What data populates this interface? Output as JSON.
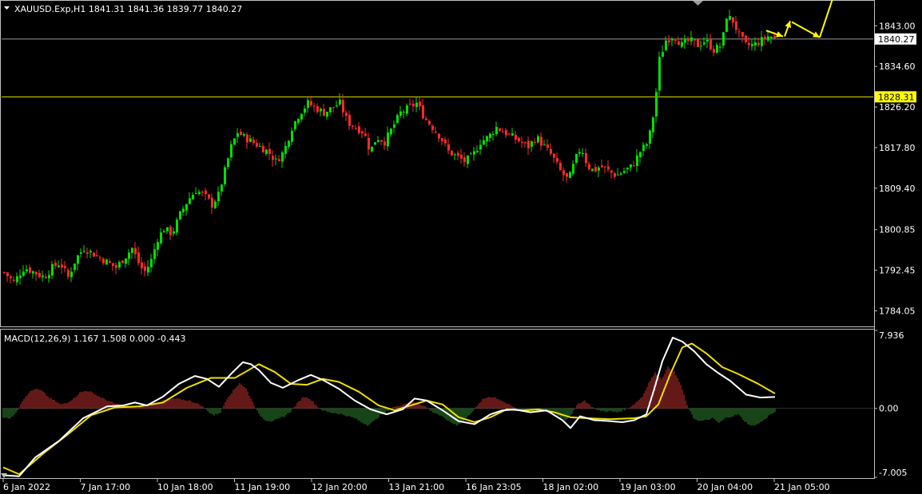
{
  "window": {
    "symbol_header": "XAUUSD.Exp,H1  1841.31 1841.36 1839.77 1840.27",
    "macd_header": "MACD(12,26,9) 1.167 1.508 0.000 -0.443"
  },
  "colors": {
    "background": "#000000",
    "frame": "#c0c0c0",
    "bull_candle": "#00e000",
    "bear_candle": "#ff2a2a",
    "bid_line": "#9a9a9a",
    "level_line": "#e0e000",
    "level_label_bg": "#ffff00",
    "macd_main": "#ffffff",
    "macd_signal": "#f0e000",
    "hist_positive": "#c83232",
    "hist_negative": "#2f8a2f",
    "arrows": "#ffff00"
  },
  "icons": {
    "header_menu": "triangle-down-icon",
    "shift_marker": "triangle-down-icon"
  },
  "chart_data": [
    {
      "type": "candlestick",
      "title": "XAUUSD.Exp,H1",
      "last_ohlc": {
        "open": 1841.31,
        "high": 1841.36,
        "low": 1839.77,
        "close": 1840.27
      },
      "y_ticks": [
        "1843.00",
        "1834.60",
        "1826.20",
        "1817.80",
        "1809.40",
        "1800.85",
        "1792.45",
        "1784.05"
      ],
      "ylim": [
        1781.0,
        1848.0
      ],
      "x_ticks": [
        "6 Jan 2022",
        "7 Jan 17:00",
        "10 Jan 18:00",
        "11 Jan 19:00",
        "12 Jan 20:00",
        "13 Jan 21:00",
        "16 Jan 23:05",
        "18 Jan 02:00",
        "19 Jan 03:00",
        "20 Jan 04:00",
        "21 Jan 05:00"
      ],
      "bid_price": "1840.27",
      "horizontal_level": "1828.31",
      "close_path": [
        [
          0,
          1792
        ],
        [
          12,
          1790
        ],
        [
          25,
          1793
        ],
        [
          38,
          1792
        ],
        [
          50,
          1791
        ],
        [
          60,
          1793
        ],
        [
          70,
          1794
        ],
        [
          80,
          1791
        ],
        [
          90,
          1795
        ],
        [
          100,
          1797
        ],
        [
          110,
          1796
        ],
        [
          120,
          1795
        ],
        [
          130,
          1794
        ],
        [
          140,
          1793
        ],
        [
          150,
          1795
        ],
        [
          160,
          1797
        ],
        [
          168,
          1794
        ],
        [
          175,
          1792
        ],
        [
          183,
          1794
        ],
        [
          192,
          1799
        ],
        [
          200,
          1801
        ],
        [
          210,
          1800
        ],
        [
          220,
          1804
        ],
        [
          230,
          1807
        ],
        [
          240,
          1809
        ],
        [
          250,
          1808
        ],
        [
          260,
          1806
        ],
        [
          268,
          1808
        ],
        [
          276,
          1813
        ],
        [
          284,
          1818
        ],
        [
          292,
          1821
        ],
        [
          300,
          1820
        ],
        [
          310,
          1819
        ],
        [
          320,
          1818
        ],
        [
          330,
          1817
        ],
        [
          340,
          1815
        ],
        [
          350,
          1817
        ],
        [
          360,
          1822
        ],
        [
          370,
          1825
        ],
        [
          380,
          1827
        ],
        [
          390,
          1826
        ],
        [
          400,
          1825
        ],
        [
          410,
          1826
        ],
        [
          420,
          1827
        ],
        [
          430,
          1823
        ],
        [
          440,
          1822
        ],
        [
          450,
          1821
        ],
        [
          458,
          1817
        ],
        [
          466,
          1820
        ],
        [
          476,
          1819
        ],
        [
          486,
          1822
        ],
        [
          496,
          1825
        ],
        [
          506,
          1826
        ],
        [
          516,
          1827
        ],
        [
          526,
          1824
        ],
        [
          536,
          1822
        ],
        [
          546,
          1820
        ],
        [
          556,
          1817
        ],
        [
          566,
          1816
        ],
        [
          576,
          1815
        ],
        [
          586,
          1816
        ],
        [
          596,
          1819
        ],
        [
          606,
          1820
        ],
        [
          616,
          1822
        ],
        [
          626,
          1821
        ],
        [
          636,
          1820
        ],
        [
          646,
          1819
        ],
        [
          656,
          1818
        ],
        [
          666,
          1820
        ],
        [
          676,
          1818
        ],
        [
          686,
          1816
        ],
        [
          696,
          1813
        ],
        [
          706,
          1811
        ],
        [
          714,
          1815
        ],
        [
          722,
          1818
        ],
        [
          730,
          1814
        ],
        [
          738,
          1813
        ],
        [
          746,
          1814
        ],
        [
          756,
          1813
        ],
        [
          766,
          1812
        ],
        [
          776,
          1813
        ],
        [
          786,
          1814
        ],
        [
          796,
          1817
        ],
        [
          806,
          1819
        ],
        [
          814,
          1826
        ],
        [
          820,
          1836
        ],
        [
          828,
          1840
        ],
        [
          838,
          1841
        ],
        [
          848,
          1839
        ],
        [
          858,
          1840
        ],
        [
          868,
          1839
        ],
        [
          878,
          1840
        ],
        [
          888,
          1838
        ],
        [
          898,
          1839
        ],
        [
          904,
          1845
        ],
        [
          912,
          1844
        ],
        [
          920,
          1841
        ],
        [
          928,
          1839
        ],
        [
          938,
          1839
        ],
        [
          948,
          1840
        ],
        [
          958,
          1841
        ],
        [
          966,
          1840
        ]
      ],
      "annotations": [
        {
          "type": "arrow_path",
          "points": [
            [
              955,
              1842.0
            ],
            [
              976,
              1840.8
            ]
          ]
        },
        {
          "type": "arrow_path",
          "points": [
            [
              978,
              1840.8
            ],
            [
              985,
              1844.0
            ]
          ]
        },
        {
          "type": "arrow_path",
          "points": [
            [
              987,
              1843.8
            ],
            [
              1022,
              1840.6
            ]
          ]
        },
        {
          "type": "arrow_path",
          "points": [
            [
              1022,
              1840.6
            ],
            [
              1043,
              1851.0
            ]
          ]
        }
      ]
    },
    {
      "type": "macd",
      "title": "MACD(12,26,9)",
      "values": {
        "main": 1.167,
        "signal": 1.508,
        "v3": 0.0,
        "histogram": -0.443
      },
      "y_ticks": [
        "7.936",
        "0.00",
        "-7.005"
      ],
      "ylim": [
        -7.005,
        7.936
      ],
      "main_line": [
        [
          0,
          -6.8
        ],
        [
          20,
          -6.9
        ],
        [
          40,
          -5.0
        ],
        [
          70,
          -3.3
        ],
        [
          100,
          -1.0
        ],
        [
          130,
          0.2
        ],
        [
          150,
          0.3
        ],
        [
          165,
          0.6
        ],
        [
          180,
          0.3
        ],
        [
          200,
          1.2
        ],
        [
          220,
          2.5
        ],
        [
          240,
          3.3
        ],
        [
          255,
          3.0
        ],
        [
          270,
          2.2
        ],
        [
          285,
          3.5
        ],
        [
          300,
          4.7
        ],
        [
          310,
          4.5
        ],
        [
          320,
          3.9
        ],
        [
          335,
          2.6
        ],
        [
          350,
          2.1
        ],
        [
          370,
          2.9
        ],
        [
          385,
          3.4
        ],
        [
          400,
          2.9
        ],
        [
          420,
          2.0
        ],
        [
          440,
          0.8
        ],
        [
          460,
          -0.1
        ],
        [
          480,
          -0.6
        ],
        [
          500,
          -0.1
        ],
        [
          515,
          1.0
        ],
        [
          530,
          0.8
        ],
        [
          550,
          -0.2
        ],
        [
          570,
          -1.3
        ],
        [
          590,
          -1.6
        ],
        [
          610,
          -0.6
        ],
        [
          625,
          -0.2
        ],
        [
          640,
          -0.1
        ],
        [
          660,
          -0.4
        ],
        [
          680,
          -0.2
        ],
        [
          700,
          -1.2
        ],
        [
          710,
          -2.0
        ],
        [
          722,
          -0.8
        ],
        [
          740,
          -1.2
        ],
        [
          760,
          -1.3
        ],
        [
          775,
          -1.4
        ],
        [
          790,
          -1.2
        ],
        [
          805,
          -0.6
        ],
        [
          815,
          2.0
        ],
        [
          825,
          4.8
        ],
        [
          838,
          7.2
        ],
        [
          850,
          6.8
        ],
        [
          865,
          5.8
        ],
        [
          880,
          4.5
        ],
        [
          895,
          3.6
        ],
        [
          910,
          2.8
        ],
        [
          930,
          1.4
        ],
        [
          948,
          1.1
        ],
        [
          966,
          1.167
        ]
      ],
      "signal_line": [
        [
          0,
          -6.0
        ],
        [
          20,
          -6.7
        ],
        [
          50,
          -4.6
        ],
        [
          80,
          -2.7
        ],
        [
          110,
          -0.7
        ],
        [
          140,
          0.1
        ],
        [
          170,
          0.2
        ],
        [
          200,
          0.6
        ],
        [
          230,
          2.1
        ],
        [
          260,
          3.1
        ],
        [
          290,
          3.1
        ],
        [
          320,
          4.5
        ],
        [
          340,
          3.7
        ],
        [
          360,
          2.5
        ],
        [
          380,
          2.4
        ],
        [
          400,
          3.0
        ],
        [
          420,
          2.7
        ],
        [
          445,
          1.7
        ],
        [
          470,
          0.3
        ],
        [
          490,
          -0.2
        ],
        [
          510,
          0.3
        ],
        [
          530,
          0.8
        ],
        [
          550,
          0.4
        ],
        [
          570,
          -0.9
        ],
        [
          590,
          -1.4
        ],
        [
          610,
          -0.9
        ],
        [
          630,
          -0.1
        ],
        [
          650,
          -0.2
        ],
        [
          670,
          -0.1
        ],
        [
          690,
          -0.4
        ],
        [
          710,
          -0.9
        ],
        [
          730,
          -1.0
        ],
        [
          760,
          -1.1
        ],
        [
          790,
          -1.0
        ],
        [
          805,
          -0.8
        ],
        [
          820,
          0.4
        ],
        [
          835,
          3.5
        ],
        [
          850,
          6.2
        ],
        [
          862,
          6.6
        ],
        [
          880,
          5.6
        ],
        [
          900,
          4.2
        ],
        [
          920,
          3.5
        ],
        [
          945,
          2.5
        ],
        [
          966,
          1.508
        ]
      ],
      "histogram": [
        [
          0,
          -0.9
        ],
        [
          8,
          -1.0
        ],
        [
          16,
          -0.5
        ],
        [
          24,
          0.8
        ],
        [
          32,
          1.6
        ],
        [
          40,
          2.0
        ],
        [
          48,
          1.8
        ],
        [
          56,
          1.2
        ],
        [
          64,
          0.8
        ],
        [
          72,
          0.4
        ],
        [
          80,
          0.6
        ],
        [
          88,
          1.0
        ],
        [
          96,
          1.6
        ],
        [
          104,
          1.8
        ],
        [
          112,
          1.6
        ],
        [
          120,
          1.2
        ],
        [
          128,
          0.9
        ],
        [
          136,
          0.6
        ],
        [
          144,
          0.4
        ],
        [
          152,
          0.3
        ],
        [
          160,
          0.2
        ],
        [
          168,
          0.1
        ],
        [
          176,
          0.3
        ],
        [
          184,
          0.5
        ],
        [
          192,
          0.6
        ],
        [
          200,
          0.8
        ],
        [
          208,
          0.9
        ],
        [
          216,
          1.0
        ],
        [
          224,
          0.9
        ],
        [
          232,
          0.8
        ],
        [
          240,
          0.6
        ],
        [
          248,
          0.3
        ],
        [
          256,
          -0.3
        ],
        [
          264,
          -0.7
        ],
        [
          272,
          -0.4
        ],
        [
          280,
          1.0
        ],
        [
          288,
          1.8
        ],
        [
          296,
          2.6
        ],
        [
          304,
          2.0
        ],
        [
          312,
          0.7
        ],
        [
          320,
          -0.6
        ],
        [
          328,
          -1.2
        ],
        [
          336,
          -1.3
        ],
        [
          344,
          -1.1
        ],
        [
          352,
          -0.8
        ],
        [
          360,
          -0.3
        ],
        [
          368,
          0.5
        ],
        [
          376,
          1.2
        ],
        [
          384,
          1.0
        ],
        [
          392,
          0.3
        ],
        [
          400,
          -0.2
        ],
        [
          408,
          -0.4
        ],
        [
          416,
          -0.5
        ],
        [
          424,
          -0.6
        ],
        [
          432,
          -0.8
        ],
        [
          440,
          -1.0
        ],
        [
          448,
          -1.4
        ],
        [
          456,
          -1.7
        ],
        [
          464,
          -1.3
        ],
        [
          472,
          -0.7
        ],
        [
          480,
          -0.3
        ],
        [
          488,
          0.1
        ],
        [
          496,
          0.3
        ],
        [
          504,
          0.5
        ],
        [
          512,
          0.7
        ],
        [
          520,
          0.5
        ],
        [
          528,
          0.2
        ],
        [
          536,
          -0.3
        ],
        [
          544,
          -0.6
        ],
        [
          552,
          -1.0
        ],
        [
          560,
          -1.4
        ],
        [
          568,
          -1.7
        ],
        [
          576,
          -1.3
        ],
        [
          584,
          -0.6
        ],
        [
          592,
          0.1
        ],
        [
          600,
          0.9
        ],
        [
          608,
          1.2
        ],
        [
          616,
          1.1
        ],
        [
          624,
          0.8
        ],
        [
          632,
          0.4
        ],
        [
          640,
          0.1
        ],
        [
          648,
          -0.2
        ],
        [
          656,
          -0.4
        ],
        [
          664,
          -0.3
        ],
        [
          672,
          -0.2
        ],
        [
          680,
          -0.2
        ],
        [
          688,
          -0.4
        ],
        [
          696,
          -0.8
        ],
        [
          704,
          -1.2
        ],
        [
          712,
          -0.5
        ],
        [
          720,
          0.5
        ],
        [
          728,
          0.8
        ],
        [
          736,
          0.2
        ],
        [
          744,
          -0.2
        ],
        [
          752,
          -0.3
        ],
        [
          760,
          -0.3
        ],
        [
          768,
          -0.4
        ],
        [
          776,
          -0.2
        ],
        [
          784,
          0.1
        ],
        [
          792,
          0.6
        ],
        [
          800,
          1.2
        ],
        [
          808,
          2.6
        ],
        [
          816,
          3.6
        ],
        [
          824,
          3.0
        ],
        [
          832,
          4.2
        ],
        [
          840,
          3.7
        ],
        [
          848,
          2.4
        ],
        [
          856,
          0.3
        ],
        [
          864,
          -1.0
        ],
        [
          872,
          -1.3
        ],
        [
          880,
          -1.2
        ],
        [
          888,
          -1.0
        ],
        [
          896,
          -1.5
        ],
        [
          904,
          -1.0
        ],
        [
          912,
          -0.8
        ],
        [
          920,
          -0.6
        ],
        [
          928,
          -1.3
        ],
        [
          936,
          -1.8
        ],
        [
          944,
          -1.6
        ],
        [
          952,
          -1.2
        ],
        [
          960,
          -0.6
        ],
        [
          966,
          -0.443
        ]
      ]
    }
  ]
}
